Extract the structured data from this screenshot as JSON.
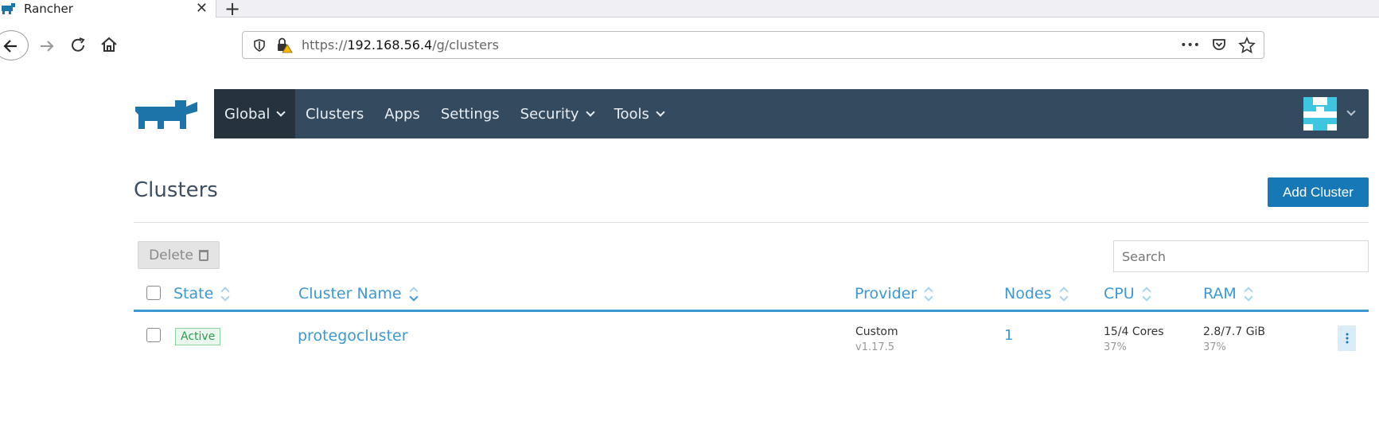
{
  "browser": {
    "tab_title": "Rancher",
    "url_prefix": "https://",
    "url_host": "192.168.56.4",
    "url_path": "/g/clusters",
    "more_label": "•••"
  },
  "header": {
    "nav": [
      {
        "label": "Global",
        "has_menu": true
      },
      {
        "label": "Clusters"
      },
      {
        "label": "Apps"
      },
      {
        "label": "Settings"
      },
      {
        "label": "Security",
        "has_menu": true
      },
      {
        "label": "Tools",
        "has_menu": true
      }
    ],
    "bar_color": "#344a5f"
  },
  "page": {
    "title": "Clusters",
    "add_button": "Add Cluster",
    "delete_button": "Delete",
    "search_placeholder": "Search"
  },
  "table": {
    "columns": [
      "State",
      "Cluster Name",
      "Provider",
      "Nodes",
      "CPU",
      "RAM"
    ],
    "rows": [
      {
        "state": "Active",
        "name": "protegocluster",
        "provider": "Custom",
        "provider_version": "v1.17.5",
        "nodes": "1",
        "cpu": "15/4 Cores",
        "cpu_pct": "37%",
        "ram": "2.8/7.7 GiB",
        "ram_pct": "37%"
      }
    ]
  },
  "colors": {
    "accent": "#3d98d3",
    "primary_button": "#1678b6",
    "active_badge": "#2e9b4f"
  }
}
